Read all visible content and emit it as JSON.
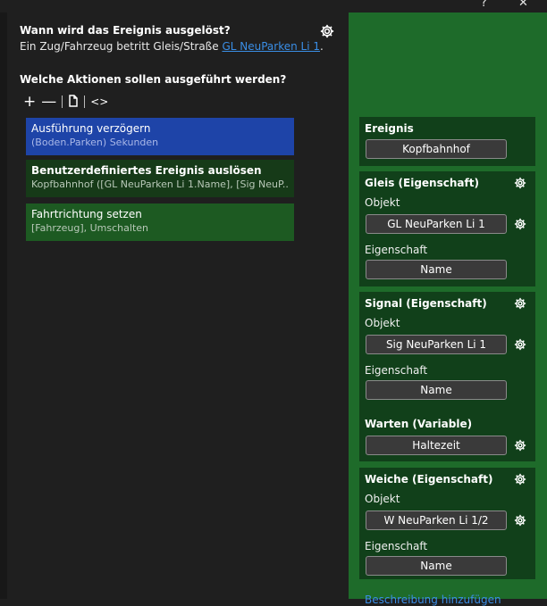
{
  "event_section": {
    "question": "Wann wird das Ereignis ausgelöst?",
    "description_prefix": "Ein Zug/Fahrzeug betritt Gleis/Straße ",
    "description_link": "GL NeuParken Li 1",
    "description_suffix": "."
  },
  "actions_section": {
    "title": "Welche Aktionen sollen ausgeführt werden?",
    "toolbar": {
      "add": "+",
      "remove": "—",
      "code": "<>"
    }
  },
  "actions": [
    {
      "title": "Ausführung verzögern",
      "subtitle": "(Boden.Parken) Sekunden"
    },
    {
      "title": "Benutzerdefiniertes Ereignis auslösen",
      "subtitle": "Kopfbahnhof ([GL NeuParken Li 1.Name], [Sig NeuP..."
    },
    {
      "title": "Fahrtrichtung setzen",
      "subtitle": "[Fahrzeug], Umschalten"
    }
  ],
  "panel": {
    "ereignis": {
      "title": "Ereignis",
      "value": "Kopfbahnhof"
    },
    "gleis": {
      "title": "Gleis (Eigenschaft)",
      "objekt_label": "Objekt",
      "objekt_value": "GL NeuParken Li 1",
      "eigenschaft_label": "Eigenschaft",
      "eigenschaft_value": "Name"
    },
    "signal": {
      "title": "Signal (Eigenschaft)",
      "objekt_label": "Objekt",
      "objekt_value": "Sig NeuParken Li 1",
      "eigenschaft_label": "Eigenschaft",
      "eigenschaft_value": "Name"
    },
    "warten": {
      "title": "Warten (Variable)",
      "value": "Haltezeit"
    },
    "weiche": {
      "title": "Weiche (Eigenschaft)",
      "objekt_label": "Objekt",
      "objekt_value": "W NeuParken Li 1/2",
      "eigenschaft_label": "Eigenschaft",
      "eigenschaft_value": "Name"
    },
    "more_link": "Beschreibung hinzufügen"
  },
  "window": {
    "help": "?",
    "close": "✕"
  },
  "colors": {
    "accent_blue": "#1e44a8",
    "panel_green": "#1e6b2a",
    "card_green": "#11401a",
    "link_blue": "#3a8ee6"
  }
}
